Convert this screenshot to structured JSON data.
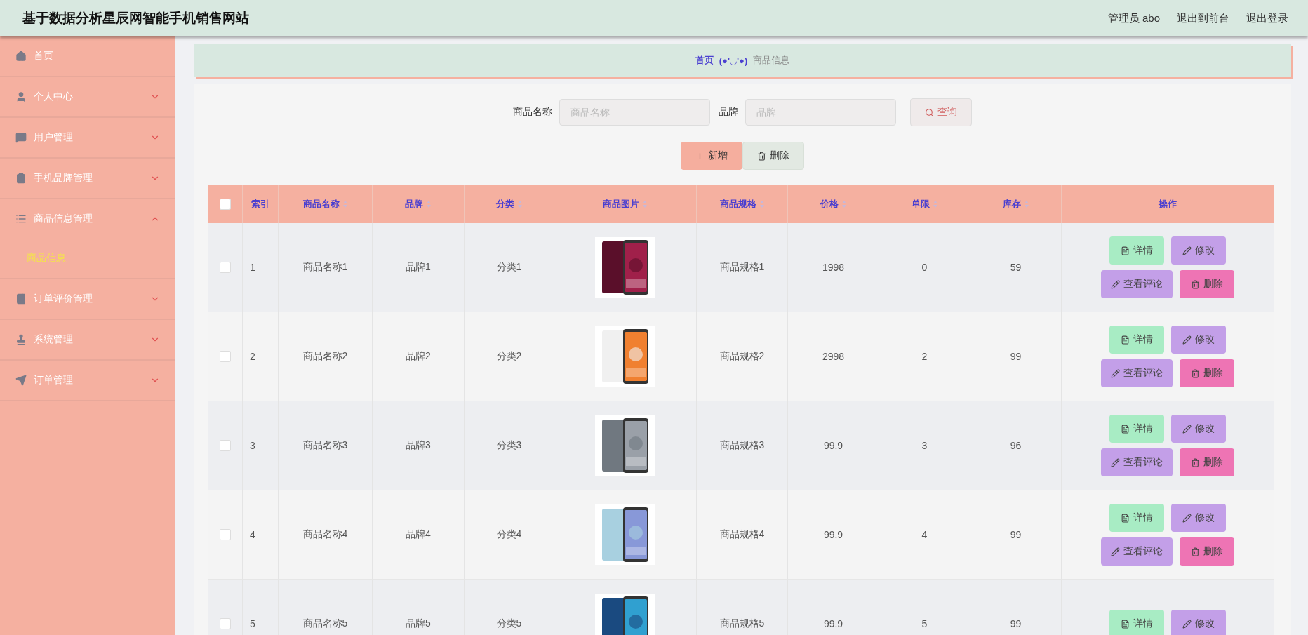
{
  "header": {
    "title": "基于数据分析星辰网智能手机销售网站",
    "links": [
      "管理员 abo",
      "退出到前台",
      "退出登录"
    ]
  },
  "sidebar": {
    "items": [
      {
        "label": "首页",
        "expandable": false
      },
      {
        "label": "个人中心",
        "expandable": true,
        "expanded": false
      },
      {
        "label": "用户管理",
        "expandable": true,
        "expanded": false
      },
      {
        "label": "手机品牌管理",
        "expandable": true,
        "expanded": false
      },
      {
        "label": "商品信息管理",
        "expandable": true,
        "expanded": true,
        "children": [
          {
            "label": "商品信息",
            "selected": true
          }
        ]
      },
      {
        "label": "订单评价管理",
        "expandable": true,
        "expanded": false
      },
      {
        "label": "系统管理",
        "expandable": true,
        "expanded": false
      },
      {
        "label": "订单管理",
        "expandable": true,
        "expanded": false
      }
    ]
  },
  "breadcrumb": {
    "home": "首页",
    "separator": "(●'◡'●)",
    "current": "商品信息"
  },
  "search": {
    "fields": [
      {
        "label": "商品名称",
        "placeholder": "商品名称"
      },
      {
        "label": "品牌",
        "placeholder": "品牌"
      }
    ],
    "button": "查询"
  },
  "toolbar": [
    {
      "kind": "add",
      "label": "新增"
    },
    {
      "kind": "delete",
      "label": "删除"
    }
  ],
  "table": {
    "select_all": {
      "checked": false
    },
    "columns": [
      {
        "label": "索引",
        "sortable": false
      },
      {
        "label": "商品名称",
        "sortable": true
      },
      {
        "label": "品牌",
        "sortable": true
      },
      {
        "label": "分类",
        "sortable": true
      },
      {
        "label": "商品图片",
        "sortable": true
      },
      {
        "label": "商品规格",
        "sortable": true
      },
      {
        "label": "价格",
        "sortable": true
      },
      {
        "label": "单限",
        "sortable": true
      },
      {
        "label": "库存",
        "sortable": true
      },
      {
        "label": "操作",
        "sortable": false
      }
    ],
    "rows": [
      {
        "checked": false,
        "cells": [
          "1",
          "商品名称1",
          "品牌1",
          "分类1"
        ],
        "image": {
          "kind": "picture"
        },
        "cells_after": [
          "商品规格1",
          "1998",
          "0",
          "59"
        ],
        "actions": [
          {
            "kind": "detail",
            "label": "详情"
          },
          {
            "kind": "edit",
            "label": "修改"
          },
          {
            "kind": "comments",
            "label": "查看评论"
          },
          {
            "kind": "delete",
            "label": "删除"
          }
        ]
      },
      {
        "checked": false,
        "cells": [
          "2",
          "商品名称2",
          "品牌2",
          "分类2"
        ],
        "image": {
          "kind": "picture"
        },
        "cells_after": [
          "商品规格2",
          "2998",
          "2",
          "99"
        ],
        "actions": [
          {
            "kind": "detail",
            "label": "详情"
          },
          {
            "kind": "edit",
            "label": "修改"
          },
          {
            "kind": "comments",
            "label": "查看评论"
          },
          {
            "kind": "delete",
            "label": "删除"
          }
        ]
      },
      {
        "checked": false,
        "cells": [
          "3",
          "商品名称3",
          "品牌3",
          "分类3"
        ],
        "image": {
          "kind": "picture"
        },
        "cells_after": [
          "商品规格3",
          "99.9",
          "3",
          "96"
        ],
        "actions": [
          {
            "kind": "detail",
            "label": "详情"
          },
          {
            "kind": "edit",
            "label": "修改"
          },
          {
            "kind": "comments",
            "label": "查看评论"
          },
          {
            "kind": "delete",
            "label": "删除"
          }
        ]
      },
      {
        "checked": false,
        "cells": [
          "4",
          "商品名称4",
          "品牌4",
          "分类4"
        ],
        "image": {
          "kind": "picture"
        },
        "cells_after": [
          "商品规格4",
          "99.9",
          "4",
          "99"
        ],
        "actions": [
          {
            "kind": "detail",
            "label": "详情"
          },
          {
            "kind": "edit",
            "label": "修改"
          },
          {
            "kind": "comments",
            "label": "查看评论"
          },
          {
            "kind": "delete",
            "label": "删除"
          }
        ]
      },
      {
        "checked": false,
        "cells": [
          "5",
          "商品名称5",
          "品牌5",
          "分类5"
        ],
        "image": {
          "kind": "picture"
        },
        "cells_after": [
          "商品规格5",
          "99.9",
          "5",
          "99"
        ],
        "actions": [
          {
            "kind": "detail",
            "label": "详情"
          },
          {
            "kind": "edit",
            "label": "修改"
          }
        ]
      }
    ]
  }
}
